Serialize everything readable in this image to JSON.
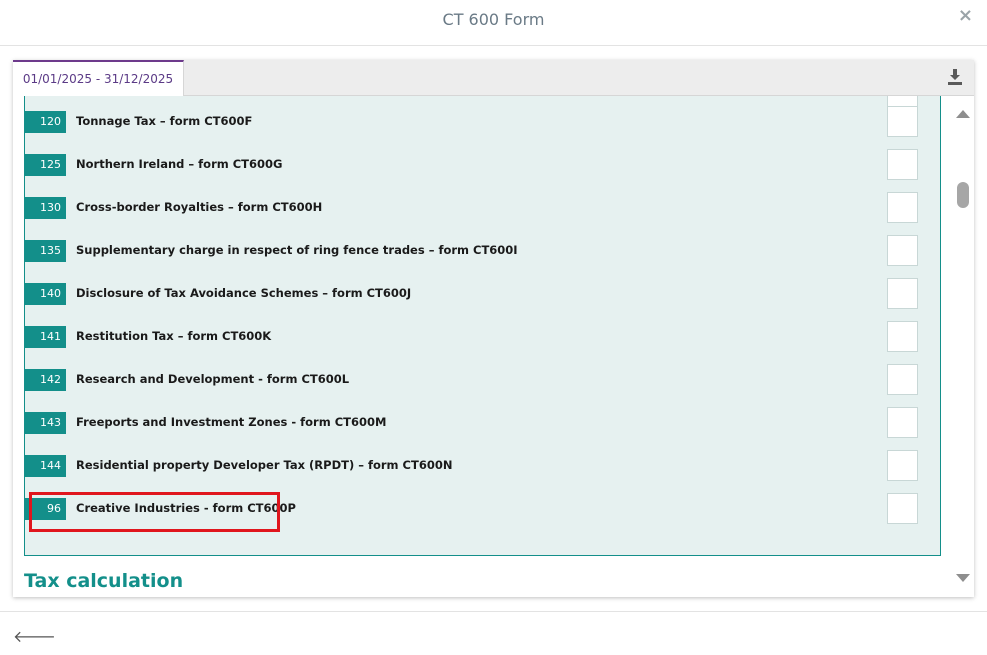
{
  "header": {
    "title": "CT 600 Form",
    "close_glyph": "×"
  },
  "tabs": [
    {
      "label": "01/01/2025 - 31/12/2025"
    }
  ],
  "toolbar": {
    "download_icon": "download-icon"
  },
  "supplementary_pages": [
    {
      "code": "120",
      "label": "Tonnage Tax – form CT600F"
    },
    {
      "code": "125",
      "label": "Northern Ireland – form CT600G"
    },
    {
      "code": "130",
      "label": "Cross-border Royalties – form CT600H"
    },
    {
      "code": "135",
      "label": "Supplementary charge in respect of ring fence trades – form CT600I"
    },
    {
      "code": "140",
      "label": "Disclosure of Tax Avoidance Schemes – form CT600J"
    },
    {
      "code": "141",
      "label": "Restitution Tax – form CT600K"
    },
    {
      "code": "142",
      "label": "Research and Development - form CT600L"
    },
    {
      "code": "143",
      "label": "Freeports and Investment Zones - form CT600M"
    },
    {
      "code": "144",
      "label": "Residential property Developer Tax (RPDT) – form CT600N"
    },
    {
      "code": "96",
      "label": "Creative Industries - form CT600P"
    }
  ],
  "section": {
    "title": "Tax calculation"
  },
  "footer": {
    "back_glyph": "🡐"
  },
  "colors": {
    "accent": "#138f8a",
    "tab_accent": "#6d3a8c",
    "highlight": "#e0161d",
    "list_bg": "#e6f1f0"
  }
}
